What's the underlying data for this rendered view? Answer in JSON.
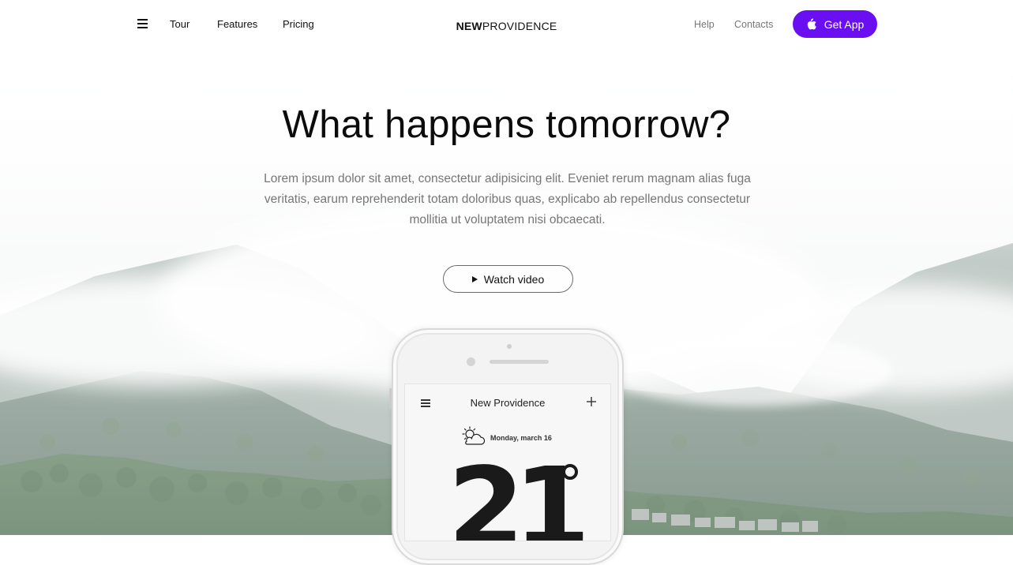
{
  "nav": {
    "links_left": [
      "Tour",
      "Features",
      "Pricing"
    ],
    "brand_bold": "NEW",
    "brand_rest": "PROVIDENCE",
    "links_right": [
      "Help",
      "Contacts"
    ],
    "cta_label": "Get App"
  },
  "hero": {
    "title": "What happens tomorrow?",
    "text": "Lorem ipsum dolor sit amet, consectetur adipisicing elit. Eveniet rerum magnam alias fuga veritatis, earum reprehenderit totam doloribus quas, explicabo ab repellendus consectetur mollitia ut voluptatem nisi obcaecati.",
    "video_label": "Watch video"
  },
  "phone_app": {
    "title": "New Providence",
    "date": "Monday, march 16",
    "temperature": "21"
  },
  "colors": {
    "accent": "#6a0ff2",
    "text": "#111111",
    "muted": "#767676"
  },
  "icons": [
    "menu-icon",
    "apple-icon",
    "play-icon",
    "plus-icon",
    "partly-cloudy-icon",
    "degree-icon"
  ]
}
